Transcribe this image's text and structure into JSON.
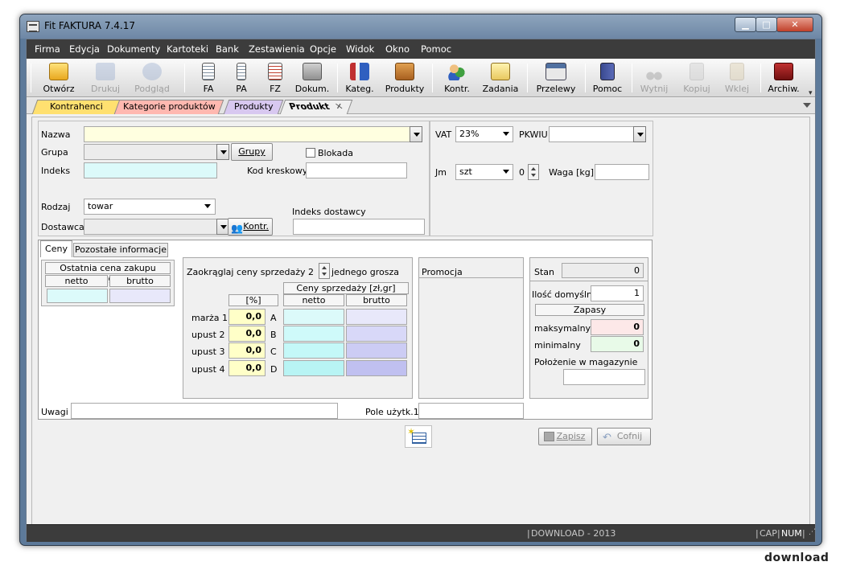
{
  "window": {
    "title": "Fit FAKTURA 7.4.17"
  },
  "menu": [
    "Firma",
    "Edycja",
    "Dokumenty",
    "Kartoteki",
    "Bank",
    "Zestawienia",
    "Opcje",
    "Widok",
    "Okno",
    "Pomoc"
  ],
  "toolbar": {
    "otworz": "Otwórz",
    "drukuj": "Drukuj",
    "podglad": "Podgląd",
    "fa": "FA",
    "pa": "PA",
    "fz": "FZ",
    "dokum": "Dokum.",
    "kateg": "Kateg.",
    "produkty": "Produkty",
    "kontr": "Kontr.",
    "zadania": "Zadania",
    "przelewy": "Przelewy",
    "pomoc": "Pomoc",
    "wytnij": "Wytnij",
    "kopiuj": "Kopiuj",
    "wklej": "Wklej",
    "archiw": "Archiw."
  },
  "tabs": [
    "Kontrahenci",
    "Kategorie produktów",
    "Produkty",
    "Produkt"
  ],
  "tab_close": "✕",
  "form": {
    "nazwa_label": "Nazwa",
    "grupa_label": "Grupa",
    "grupy_button": "Grupy",
    "blokada_label": "Blokada",
    "indeks_label": "Indeks",
    "kod_kreskowy_label": "Kod kreskowy",
    "rodzaj_label": "Rodzaj",
    "rodzaj_value": "towar",
    "dostawca_label": "Dostawca",
    "kontr_button": "Kontr.",
    "indeks_dostawcy_label": "Indeks dostawcy",
    "vat_label": "VAT",
    "vat_value": "23%",
    "pkwiu_label": "PKWIU",
    "jm_label": "Jm",
    "jm_value": "szt",
    "jm_precision": "0",
    "waga_label": "Waga [kg]"
  },
  "subtabs": [
    "Ceny",
    "Pozostałe informacje"
  ],
  "ceny": {
    "ostatnia_header": "Ostatnia cena zakupu [zł,gr]",
    "netto": "netto",
    "brutto": "brutto",
    "zaokraglaj_label": "Zaokrąglaj ceny sprzedaży",
    "zaokraglaj_value": "2",
    "zaokraglaj_suffix": "jednego grosza",
    "ceny_sprzedazy_header": "Ceny sprzedaży  [zł,gr]",
    "percent_header": "[%]",
    "rows": [
      {
        "label": "marża 1",
        "value": "0,0",
        "letter": "A"
      },
      {
        "label": "upust 2",
        "value": "0,0",
        "letter": "B"
      },
      {
        "label": "upust 3",
        "value": "0,0",
        "letter": "C"
      },
      {
        "label": "upust 4",
        "value": "0,0",
        "letter": "D"
      }
    ],
    "promocja_label": "Promocja",
    "stan_label": "Stan",
    "stan_value": "0",
    "ilosc_domyslna_label": "Ilość domyślna",
    "ilosc_domyslna_value": "1",
    "zapasy_header": "Zapasy",
    "maksymalny_label": "maksymalny",
    "maksymalny_value": "0",
    "minimalny_label": "minimalny",
    "minimalny_value": "0",
    "polozenie_label": "Położenie w magazynie",
    "uwagi_label": "Uwagi",
    "pole_label": "Pole użytk.1"
  },
  "actions": {
    "zapisz": "Zapisz",
    "cofnij": "Cofnij"
  },
  "status": {
    "download": "DOWNLOAD - 2013",
    "cap": "CAP",
    "num": "NUM"
  },
  "watermark": "download",
  "colors": {
    "menubar": "#3c3c3c",
    "field_yellow": "#ffffe0",
    "field_cyan": "#dcfafa",
    "field_violet": "#e8e8fa"
  }
}
